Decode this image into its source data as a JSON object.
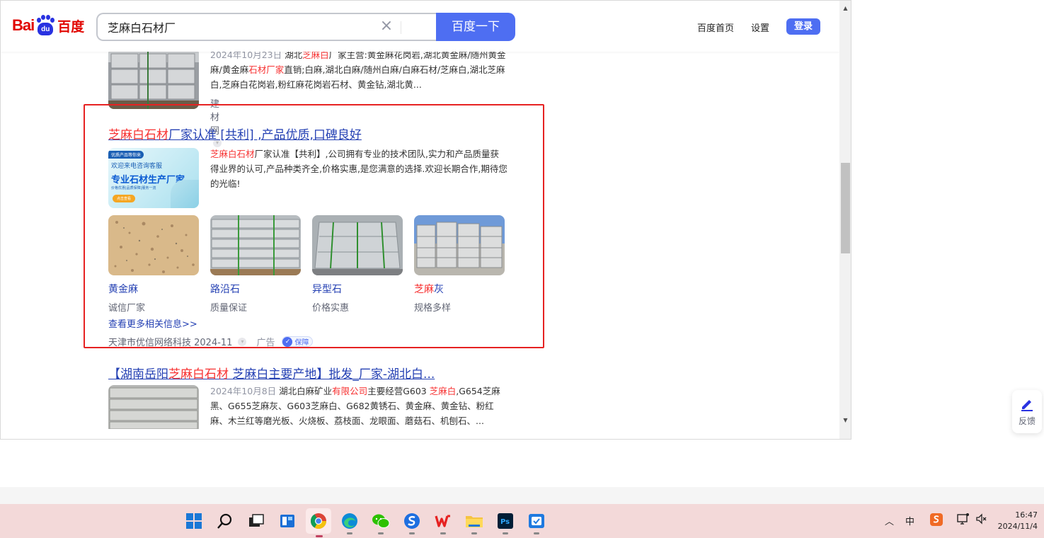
{
  "header": {
    "logo_bai": "Bai",
    "logo_du": "du",
    "logo_cn": "百度",
    "search_value": "芝麻白石材厂",
    "search_button": "百度一下",
    "nav_home": "百度首页",
    "nav_settings": "设置",
    "login": "登录"
  },
  "result_top": {
    "date": "2024年10月23日",
    "desc_pre": "湖北",
    "desc_hl1": "芝麻白",
    "desc_mid1": "厂家主营:黄金麻花岗岩,湖北黄金麻/随州黄金麻/黄金麻",
    "desc_hl2": "石材厂家",
    "desc_post": "直销;白麻,湖北白麻/随州白麻/白麻石材/芝麻白,湖北芝麻白,芝麻白花岗岩,粉红麻花岗岩石材、黄金钻,湖北黄...",
    "source": "建材网"
  },
  "ad_result": {
    "title_hl": "芝麻白石材",
    "title_rest": "厂家认准 [共利] ,产品优质,口碑良好",
    "banner_top": "优质产品等你来",
    "banner_l1": "欢迎来电咨询客服",
    "banner_l2": "专业石材生产厂家",
    "banner_l3": "价格优惠|品质保障|服务一流",
    "banner_btn": "点击查看",
    "desc_hl": "芝麻白石材",
    "desc_rest": "厂家认准【共利】,公司拥有专业的技术团队,实力和产品质量获得业界的认可,产品种类齐全,价格实惠,是您满意的选择.欢迎长期合作,期待您的光临!",
    "products": [
      {
        "name": "黄金麻",
        "name_hl": "",
        "sub": "诚信厂家"
      },
      {
        "name": "路沿石",
        "name_hl": "",
        "sub": "质量保证"
      },
      {
        "name": "异型石",
        "name_hl": "",
        "sub": "价格实惠"
      },
      {
        "name": "灰",
        "name_hl": "芝麻",
        "sub": "规格多样"
      }
    ],
    "more_link": "查看更多相关信息>>",
    "source": "天津市优信网络科技 2024-11",
    "ad_label": "广告",
    "guarantee": "保障"
  },
  "result_bottom": {
    "title_pre": "【湖南岳阳",
    "title_hl": "芝麻白石材",
    "title_rest": " 芝麻白主要产地】批发_厂家-湖北白...",
    "date": "2024年10月8日",
    "desc_a": "湖北白麻矿业",
    "desc_hl1": "有限公司",
    "desc_b": "主要经营G603 ",
    "desc_hl2": "芝麻白",
    "desc_c": ",G654芝麻黑、G655芝麻灰、G603芝麻白、G682黄锈石、黄金麻、黄金钻、粉红麻、木兰红等磨光板、火烧板、荔枝面、龙眼面、蘑菇石、机刨石、..."
  },
  "feedback": "反馈",
  "tray": {
    "ime": "中",
    "time": "16:47",
    "date": "2024/11/4"
  },
  "colors": {
    "accent": "#4e6ef2",
    "highlight": "#f73131",
    "link": "#2440b3",
    "ad_border": "#e62222",
    "taskbar": "#f3d9d9"
  }
}
